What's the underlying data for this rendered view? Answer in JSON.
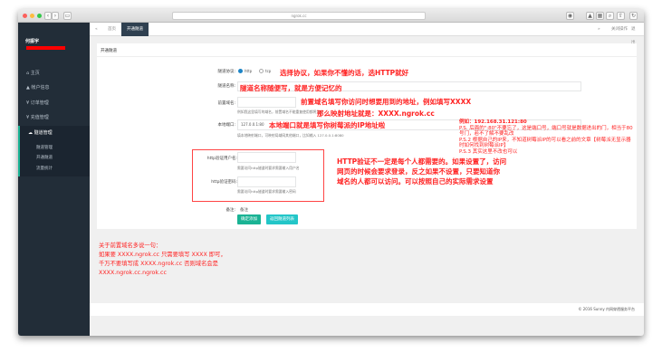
{
  "browser": {
    "url": "ngrok.cc"
  },
  "sidebar": {
    "user": "何振宇",
    "items": [
      {
        "label": "主页"
      },
      {
        "label": "帐户信息"
      },
      {
        "label": "订单管理"
      },
      {
        "label": "充值管理"
      },
      {
        "label": "隧道管理"
      }
    ],
    "subitems": [
      {
        "label": "隧道管理"
      },
      {
        "label": "开通隧道"
      },
      {
        "label": "流量统计"
      }
    ]
  },
  "topnav": {
    "tabs": [
      {
        "label": "首页"
      },
      {
        "label": "开通隧道"
      }
    ],
    "actions": [
      {
        "label": "关闭操作"
      },
      {
        "label": "退出"
      }
    ]
  },
  "card": {
    "title": "开通隧道"
  },
  "form": {
    "protocol_label": "隧道协议:",
    "protocol_options": [
      "http",
      "tcp"
    ],
    "protocol_selected": "http",
    "name_label": "隧道名称:",
    "domain_label": "前置域名:",
    "domain_help": "例如我这里填写的域名，前置域名不能重复使用都将为空",
    "port_label": "本地端口:",
    "port_value": "127.0.0.1:80",
    "port_help": "填本地映射端口，可映射局域网其他端口，比如输入 127.0.0.1:8080",
    "user_label": "http验证用户名:",
    "user_help": "需要访问http隧道时要求需要输入用户名",
    "pass_label": "http验证密码:",
    "pass_help": "需要访问http隧道时要求需要输入密码",
    "remark_label": "备注:",
    "remark_value": "备注",
    "submit": "确定添加",
    "back": "返回隧道列表"
  },
  "annotations": {
    "protocol": "选择协议，如果你不懂的话，选HTTP就好",
    "name": "隧道名称随便写，就是方便记忆的",
    "domain1": "前置域名填写你访问时想要用到的地址，例如填写XXXX",
    "domain2": "那么映射地址就是：XXXX.ngrok.cc",
    "port": "本地端口就是填写你树莓派的IP地址啦",
    "port_example": "例如：192.168.31.121:80",
    "ps1": "P.S. 后面的\":80\"不要忘了，这是端口号，端口号就是数据进出的门，相当于80号门，若不了解不要乱改",
    "ps2": "P.S.2 根据自己的IP来，不知道树莓派IP的可以看之前的文章【树莓派无显示器时如何找到树莓派IP】",
    "ps3": "P.S.3 其实这里不改也可以",
    "http1": "HTTP验证不一定是每个人都需要的。如果设置了，访问",
    "http2": "网页的时候会要求登录，反之如果不设置，只要知道你",
    "http3": "域名的人都可以访问。可以按照自己的实际需求设置",
    "bottom": [
      "关于前置域名多说一句：",
      "如果要 XXXX.ngrok.cc 只需要填写 XXXX 即可，",
      "千万不要填写成 XXXX.ngrok.cc 否则域名会是",
      "XXXX.ngrok.cc.ngrok.cc"
    ]
  },
  "footer": {
    "text": "© 2016 Sunny 内网穿透服务平台"
  },
  "colors": {
    "sidebar": "#222d38",
    "accent": "#1ab394",
    "info": "#23c6c8",
    "annotation": "#ff2222"
  }
}
